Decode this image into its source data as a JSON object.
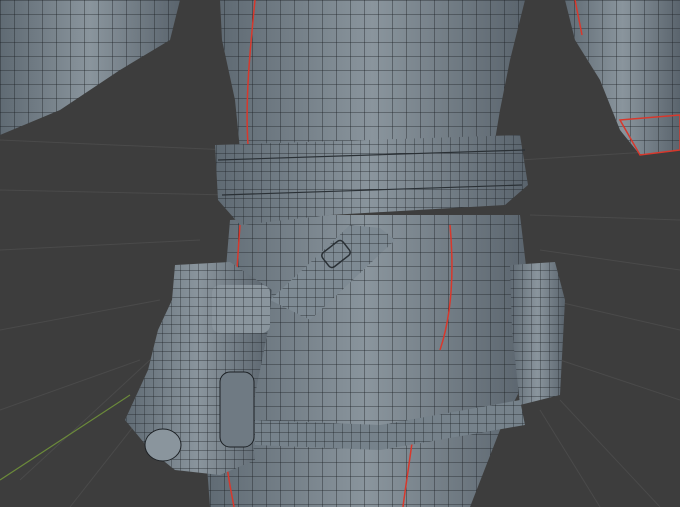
{
  "viewport": {
    "mode": "edit-mode-wireframe-overlay",
    "background_color": "#3d3d3d",
    "grid_color": "#4a4a4a",
    "axis_color": "#6b8a3a",
    "mesh_face_color": "#7b8790",
    "mesh_shadow_color": "#4f5962",
    "wire_color": "#1c2024",
    "seam_color": "#d8382c"
  },
  "model": {
    "parts": [
      "left-arm-sleeve",
      "torso",
      "right-sleeve-cuff",
      "belt",
      "leg-holster-pouches",
      "right-hip-pouch",
      "pants-left-leg",
      "pants-right-leg",
      "thigh-strap"
    ]
  }
}
